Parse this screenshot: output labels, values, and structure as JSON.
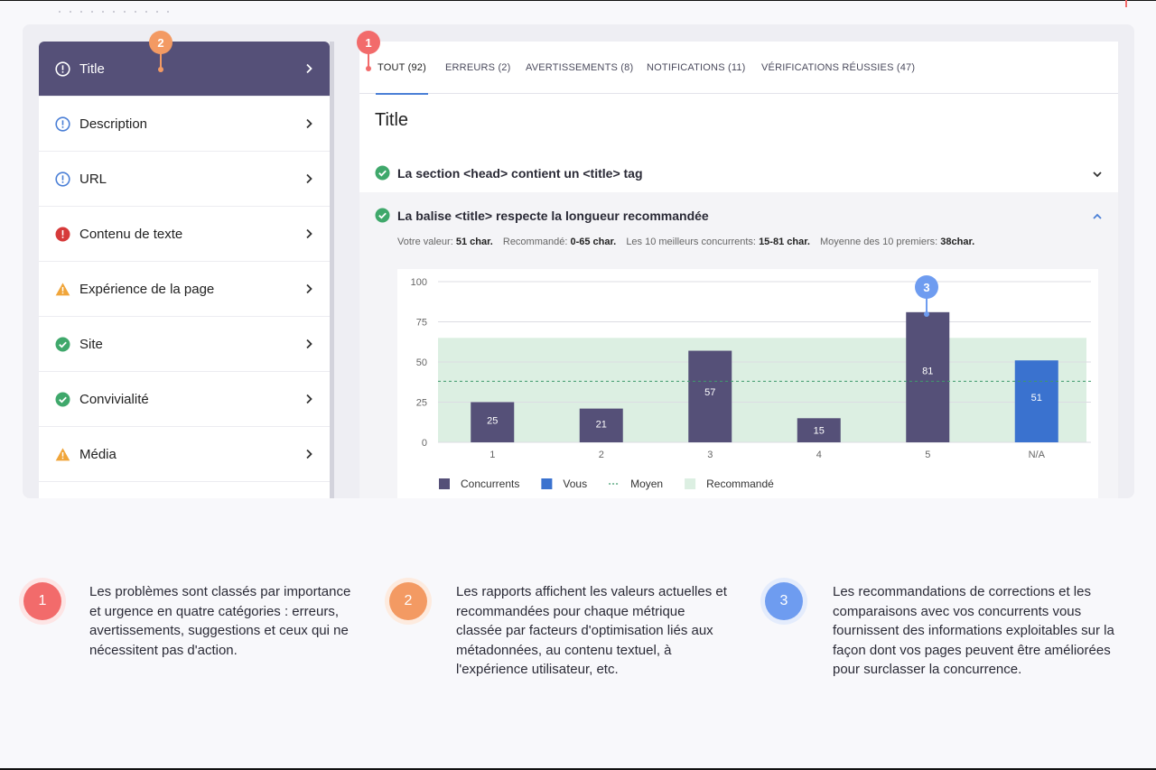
{
  "sidebar": {
    "items": [
      {
        "label": "Title",
        "icon": "exclamation-circle-icon",
        "status": "info",
        "active": true
      },
      {
        "label": "Description",
        "icon": "exclamation-circle-icon",
        "status": "info"
      },
      {
        "label": "URL",
        "icon": "exclamation-circle-icon",
        "status": "info"
      },
      {
        "label": "Contenu de texte",
        "icon": "error-circle-icon",
        "status": "error"
      },
      {
        "label": "Expérience de la page",
        "icon": "warning-triangle-icon",
        "status": "warning"
      },
      {
        "label": "Site",
        "icon": "check-circle-icon",
        "status": "ok"
      },
      {
        "label": "Convivialité",
        "icon": "check-circle-icon",
        "status": "ok"
      },
      {
        "label": "Média",
        "icon": "warning-triangle-icon",
        "status": "warning"
      }
    ]
  },
  "tabs": [
    {
      "label": "TOUT (92)",
      "active": true
    },
    {
      "label": "ERREURS (2)"
    },
    {
      "label": "AVERTISSEMENTS (8)"
    },
    {
      "label": "NOTIFICATIONS (11)"
    },
    {
      "label": "VÉRIFICATIONS RÉUSSIES (47)"
    }
  ],
  "section_title": "Title",
  "checks": [
    {
      "label": "La section <head> contient un <title> tag",
      "expanded": false
    },
    {
      "label": "La balise <title> respecte la longueur recommandée",
      "expanded": true
    }
  ],
  "metrics": {
    "value_label": "Votre valeur:",
    "value": "51 char.",
    "recommended_label": "Recommandé:",
    "recommended": "0-65 char.",
    "top_label": "Les 10 meilleurs concurrents:",
    "top": "15-81 char.",
    "avg_label": "Moyenne des 10 premiers:",
    "avg": "38char."
  },
  "markers": [
    "1",
    "2",
    "3"
  ],
  "chart_data": {
    "type": "bar",
    "categories": [
      "1",
      "2",
      "3",
      "4",
      "5",
      "N/A"
    ],
    "values": [
      25,
      21,
      57,
      15,
      81,
      51
    ],
    "bar_series": [
      "competitors",
      "competitors",
      "competitors",
      "competitors",
      "competitors",
      "you"
    ],
    "ylim": [
      0,
      100
    ],
    "yticks": [
      0,
      25,
      50,
      75,
      100
    ],
    "average": 38,
    "recommended_range": [
      0,
      65
    ],
    "grid": true,
    "legend_position": "bottom-left",
    "legend": [
      {
        "name": "Concurrents",
        "kind": "bar",
        "color": "#555078"
      },
      {
        "name": "Vous",
        "kind": "bar",
        "color": "#3a72cf"
      },
      {
        "name": "Moyen",
        "kind": "dashed-line",
        "color": "#3f9a6c"
      },
      {
        "name": "Recommandé",
        "kind": "area",
        "color": "#dcefe2"
      }
    ],
    "colors": {
      "competitors": "#555078",
      "you": "#3a72cf",
      "recommended": "#dcefe2",
      "average": "#3f9a6c"
    }
  },
  "callouts": [
    {
      "number": "1",
      "text": "Les problèmes sont classés par importance et urgence en quatre catégories : erreurs, avertissements, suggestions et ceux qui ne nécessitent pas d'action."
    },
    {
      "number": "2",
      "text": "Les rapports affichent les valeurs actuelles et recommandées pour chaque métrique classée par facteurs d'optimisation liés aux métadonnées, au contenu textuel, à l'expérience utilisateur, etc."
    },
    {
      "number": "3",
      "text": "Les recommandations de corrections et les comparaisons avec vos concurrents vous fournissent des informations exploitables sur la façon dont vos pages peuvent être améliorées pour surclasser la concurrence."
    }
  ],
  "colors": {
    "sidebar_active": "#555078",
    "accent_blue": "#4a7fd6",
    "ok": "#3fa86b",
    "error": "#d63a3a",
    "warning": "#f0a53a",
    "info": "#4a7fd6"
  }
}
